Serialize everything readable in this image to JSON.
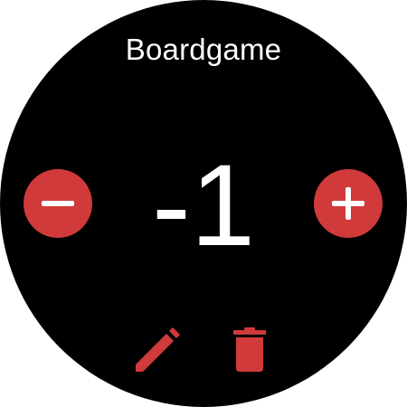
{
  "app": {
    "title": "Boardgame"
  },
  "counter": {
    "value": "-1"
  },
  "controls": {
    "decrement_icon": "minus-icon",
    "increment_icon": "plus-icon",
    "edit_icon": "pencil-icon",
    "delete_icon": "trash-icon"
  },
  "colors": {
    "accent": "#d03a3a",
    "background": "#000000",
    "text": "#ffffff"
  }
}
